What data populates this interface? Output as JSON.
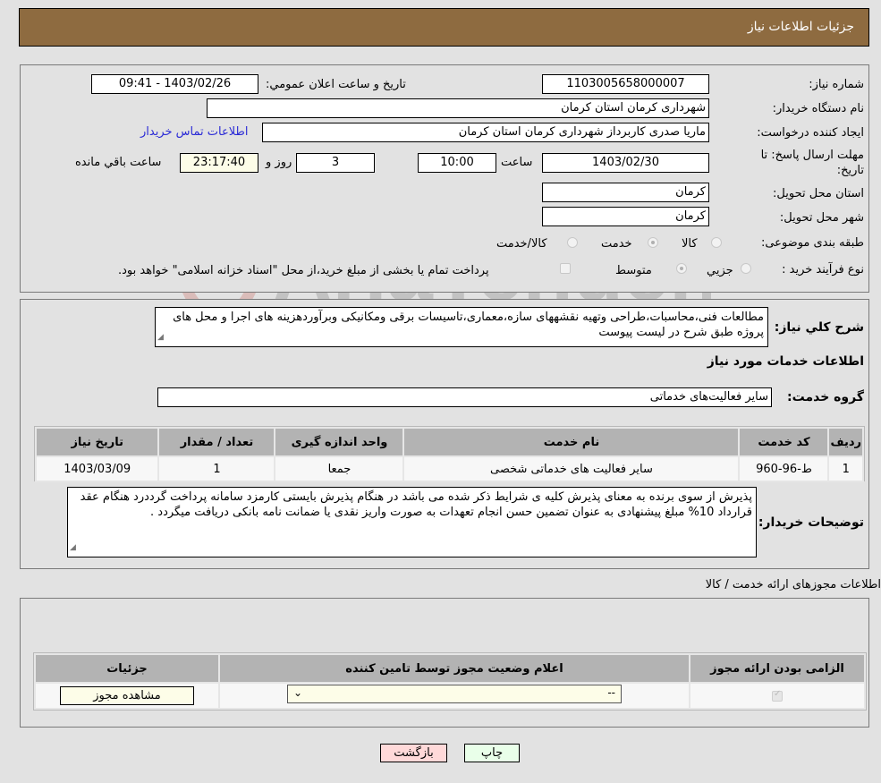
{
  "header": {
    "title": "جزئیات اطلاعات نیاز"
  },
  "info": {
    "need_number_label": "شماره نیاز:",
    "need_number": "1103005658000007",
    "announce_label": "تاریخ و ساعت اعلان عمومي:",
    "announce_value": "1403/02/26 - 09:41",
    "buyer_org_label": "نام دستگاه خریدار:",
    "buyer_org": "شهرداری کرمان استان کرمان",
    "creator_label": "ایجاد کننده درخواست:",
    "creator": "ماریا صدری کاربرداز شهرداری کرمان استان کرمان",
    "contact_link": "اطلاعات تماس خریدار",
    "deadline_label_1": "مهلت ارسال پاسخ: تا",
    "deadline_label_2": "تاریخ:",
    "deadline_date": "1403/02/30",
    "time_label": "ساعت",
    "deadline_time": "10:00",
    "days_value": "3",
    "days_label": "روز و",
    "remaining_time": "23:17:40",
    "remaining_label": "ساعت باقي مانده",
    "province_label": "استان محل تحویل:",
    "province": "کرمان",
    "city_label": "شهر محل تحویل:",
    "city": "کرمان",
    "category_label": "طبقه بندی موضوعی:",
    "category_options": [
      {
        "label": "کالا",
        "checked": false
      },
      {
        "label": "خدمت",
        "checked": true
      },
      {
        "label": "کالا/خدمت",
        "checked": false
      }
    ],
    "process_label": "نوع فرآیند خرید :",
    "process_options": [
      {
        "label": "جزيي",
        "checked": false
      },
      {
        "label": "متوسط",
        "checked": true
      }
    ],
    "treasury_checkbox_label": "پرداخت تمام یا بخشی از مبلغ خرید،از محل \"اسناد خزانه اسلامی\" خواهد بود.",
    "treasury_checked": false
  },
  "description": {
    "label": "شرح كلي نياز:",
    "text": "مطالعات فنی،محاسبات،طراحی وتهیه نقشههای سازه،معماری،تاسیسات برقی ومکانیکی وبرآوردهزینه های اجرا و محل های پروژه طبق شرح در لیست پیوست",
    "services_title": "اطلاعات خدمات مورد نياز",
    "group_label": "گروه خدمت:",
    "group_value": "سایر فعالیت‌های خدماتی"
  },
  "services_table": {
    "headers": [
      "ردیف",
      "کد خدمت",
      "نام خدمت",
      "واحد اندازه گیری",
      "تعداد / مقدار",
      "تاریخ نیاز"
    ],
    "rows": [
      [
        "1",
        "ط-96-960",
        "سایر فعالیت های خدماتی شخصی",
        "جمعا",
        "1",
        "1403/03/09"
      ]
    ]
  },
  "buyer_notes": {
    "label": "توضیحات خریدار:",
    "text": "پذیرش از سوی برنده به معنای پذیرش کلیه ی شرایط ذکر شده می باشد در هنگام پذیرش بایستی کارمزد سامانه پرداخت گرددرد هنگام عقد قرارداد 10% مبلغ پیشنهادی به عنوان تضمین حسن انجام تعهدات به صورت واریز نقدی یا ضمانت نامه بانکی دریافت میگردد ."
  },
  "permits": {
    "title": "اطلاعات مجوزهای ارائه خدمت / کالا",
    "headers": [
      "الزامی بودن ارائه مجوز",
      "اعلام وضعیت مجوز توسط تامین کننده",
      "جزئیات"
    ],
    "row": {
      "required_checked": true,
      "status_selected": "--",
      "details_button": "مشاهده مجوز"
    }
  },
  "footer": {
    "print_button": "چاپ",
    "back_button": "بازگشت"
  },
  "watermark": {
    "text": "AriaTender.neT"
  },
  "colors": {
    "header_bg": "#8e6b40",
    "link": "#2b2bd6",
    "back_bg": "#ffd9d9",
    "print_bg": "#e9ffe9"
  }
}
